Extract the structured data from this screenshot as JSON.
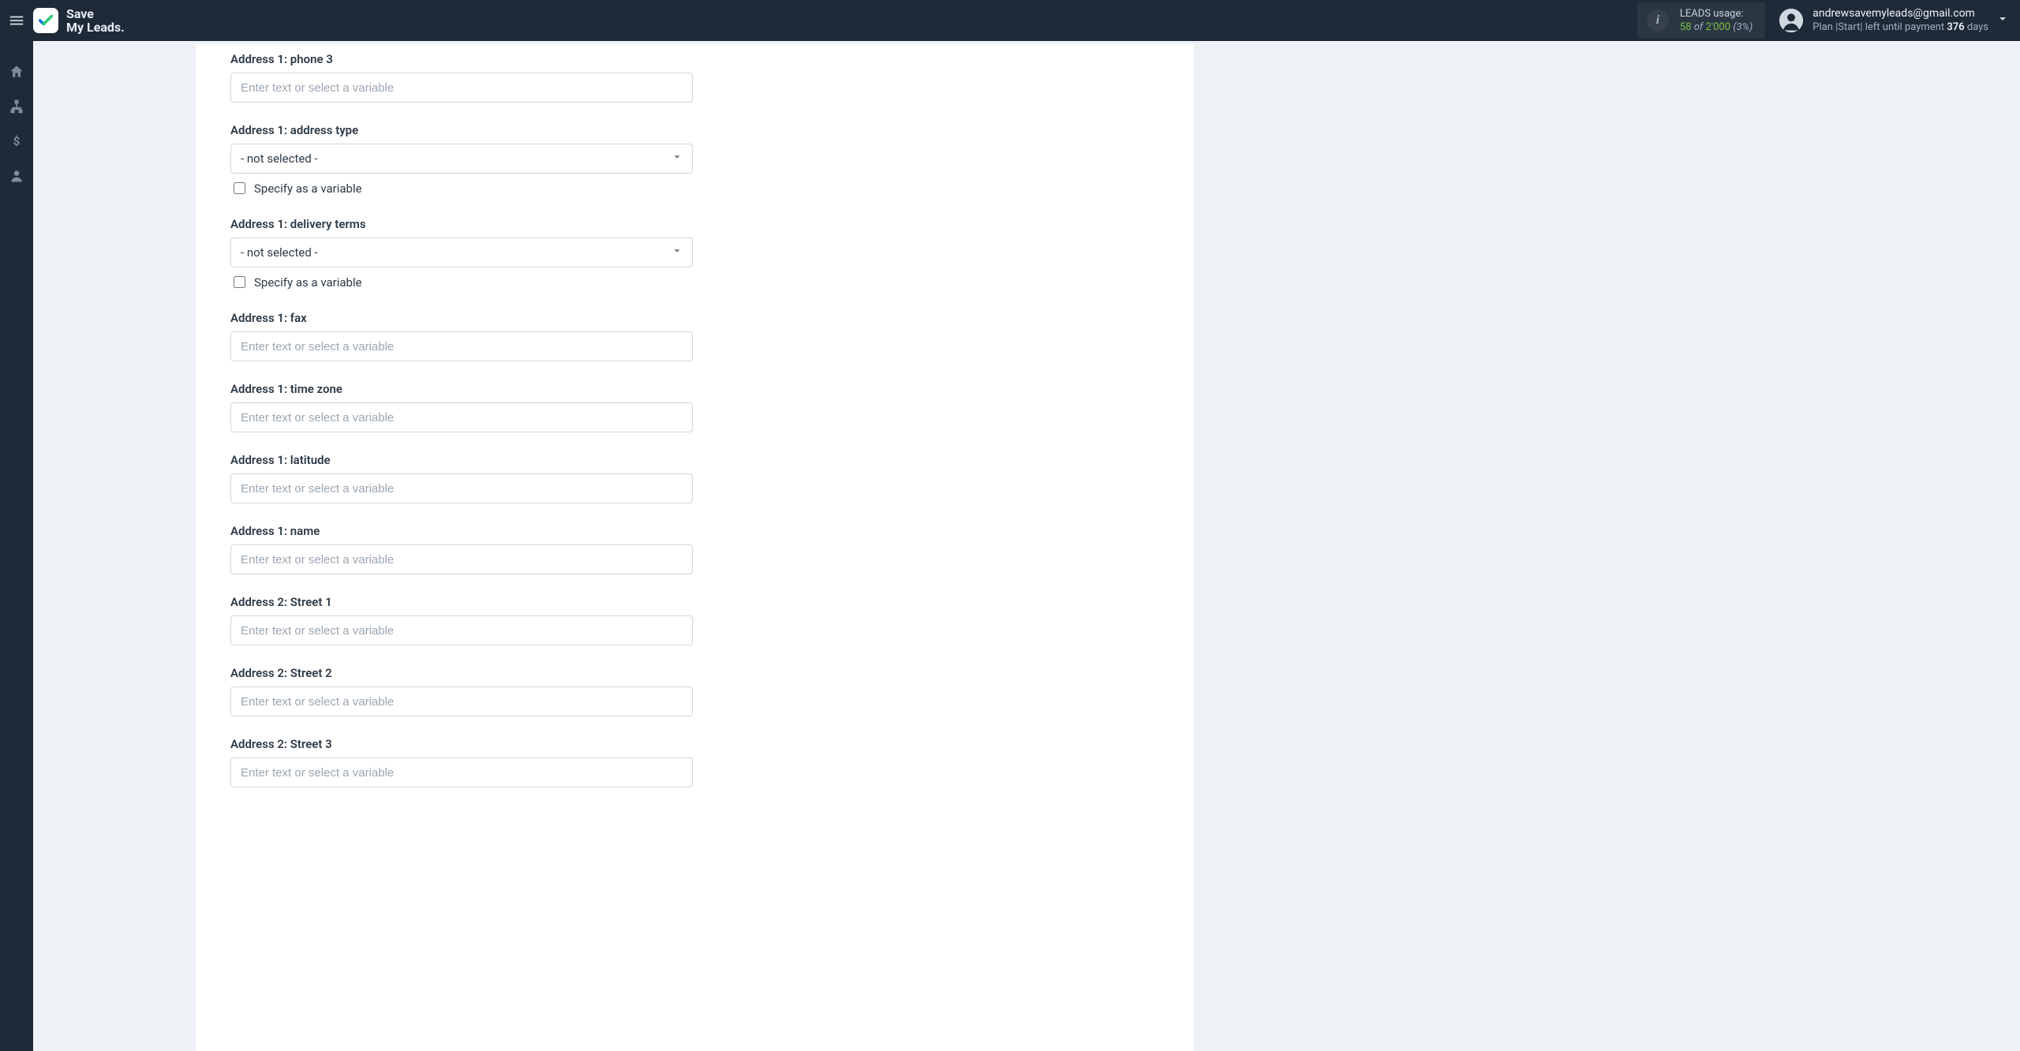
{
  "brand": {
    "line1": "Save",
    "line2": "My Leads."
  },
  "usage": {
    "title": "LEADS usage:",
    "current": "58",
    "of_word": "of",
    "total": "2'000",
    "percent": "(3%)"
  },
  "user": {
    "email": "andrewsavemyleads@gmail.com",
    "plan_prefix": "Plan |Start| left until payment ",
    "days": "376",
    "days_suffix": " days"
  },
  "common": {
    "placeholder": "Enter text or select a variable",
    "not_selected": "- not selected -",
    "specify_variable": "Specify as a variable"
  },
  "fields": [
    {
      "key": "addr1_phone3",
      "label": "Address 1: phone 3",
      "type": "text"
    },
    {
      "key": "addr1_address_type",
      "label": "Address 1: address type",
      "type": "select"
    },
    {
      "key": "addr1_delivery",
      "label": "Address 1: delivery terms",
      "type": "select"
    },
    {
      "key": "addr1_fax",
      "label": "Address 1: fax",
      "type": "text"
    },
    {
      "key": "addr1_timezone",
      "label": "Address 1: time zone",
      "type": "text"
    },
    {
      "key": "addr1_latitude",
      "label": "Address 1: latitude",
      "type": "text"
    },
    {
      "key": "addr1_name",
      "label": "Address 1: name",
      "type": "text"
    },
    {
      "key": "addr2_street1",
      "label": "Address 2: Street 1",
      "type": "text"
    },
    {
      "key": "addr2_street2",
      "label": "Address 2: Street 2",
      "type": "text"
    },
    {
      "key": "addr2_street3",
      "label": "Address 2: Street 3",
      "type": "text"
    }
  ]
}
